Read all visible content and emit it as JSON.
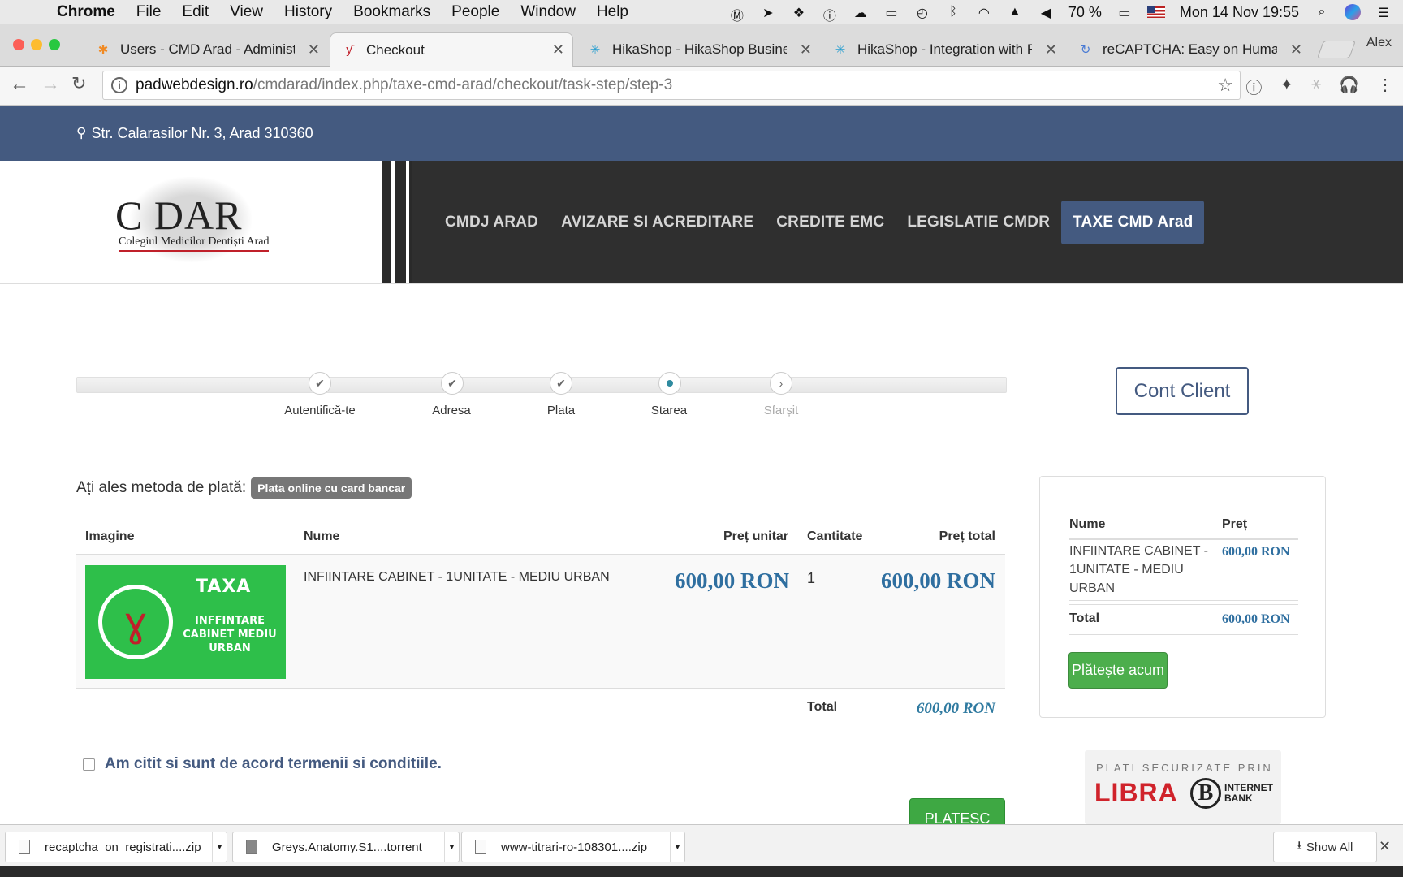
{
  "menubar": {
    "app": "Chrome",
    "items": [
      "File",
      "Edit",
      "View",
      "History",
      "Bookmarks",
      "People",
      "Window",
      "Help"
    ],
    "battery": "70 %",
    "clock": "Mon 14 Nov  19:55"
  },
  "tabs": [
    {
      "title": "Users - CMD Arad - Administr",
      "icon": "joomla-icon"
    },
    {
      "title": "Checkout",
      "icon": "tooth-icon"
    },
    {
      "title": "HikaShop - HikaShop Busines",
      "icon": "hikashop-icon"
    },
    {
      "title": "HikaShop - Integration with Re",
      "icon": "hikashop-icon"
    },
    {
      "title": "reCAPTCHA: Easy on Humans",
      "icon": "recaptcha-icon"
    }
  ],
  "profile": "Alex",
  "address": {
    "host": "padwebdesign.ro",
    "path": "/cmdarad/index.php/taxe-cmd-arad/checkout/task-step/step-3"
  },
  "site": {
    "address_line": "Str. Calarasilor Nr. 3, Arad 310360",
    "logo_word": "C DAR",
    "logo_sub": "Colegiul Medicilor Dentiști Arad",
    "menu": [
      "CMDJ ARAD",
      "AVIZARE SI ACREDITARE",
      "CREDITE EMC",
      "LEGISLATIE CMDR",
      "TAXE CMD Arad"
    ]
  },
  "steps": [
    {
      "label": "Autentifică-te",
      "state": "done"
    },
    {
      "label": "Adresa",
      "state": "done"
    },
    {
      "label": "Plata",
      "state": "done"
    },
    {
      "label": "Starea",
      "state": "current"
    },
    {
      "label": "Sfarșit",
      "state": "next"
    }
  ],
  "cont_client": "Cont Client",
  "payment": {
    "label": "Ați ales metoda de plată:",
    "method": "Plata online cu card bancar"
  },
  "cart": {
    "headers": {
      "image": "Imagine",
      "name": "Nume",
      "unit_price": "Preț unitar",
      "qty": "Cantitate",
      "total_price": "Preț total"
    },
    "item": {
      "img_title": "TAXA",
      "img_sub": "INFFINTARE CABINET MEDIU URBAN",
      "name": "INFIINTARE CABINET - 1UNITATE - MEDIU URBAN",
      "unit_price": "600,00 RON",
      "qty": "1",
      "total": "600,00 RON"
    },
    "total_label": "Total",
    "total_value": "600,00 RON"
  },
  "terms": "Am citit si sunt de acord termenii si conditiile.",
  "platesc": "PLATESC",
  "summary": {
    "h_name": "Nume",
    "h_price": "Preț",
    "item_name": "INFIINTARE CABINET - 1UNITATE - MEDIU URBAN",
    "item_price": "600,00 RON",
    "total_label": "Total",
    "total_value": "600,00 RON",
    "pay_button": "Plătește acum"
  },
  "libra": {
    "l1": "PLATI SECURIZATE PRIN",
    "l2": "LIBRA",
    "b": "B",
    "l3a": "INTERNET",
    "l3b": "BANK"
  },
  "downloads": [
    {
      "name": "recaptcha_on_registrati....zip"
    },
    {
      "name": "Greys.Anatomy.S1....torrent"
    },
    {
      "name": "www-titrari-ro-108301....zip"
    }
  ],
  "show_all": "Show All"
}
